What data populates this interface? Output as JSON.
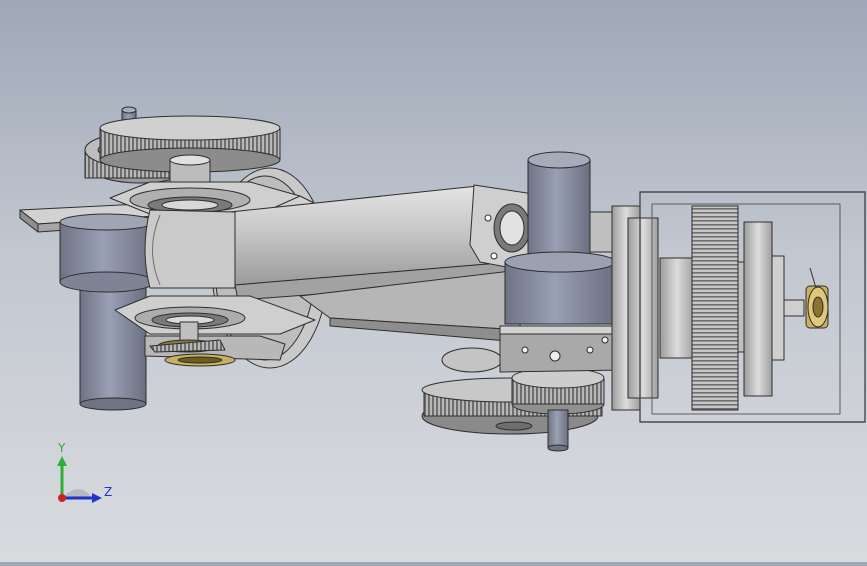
{
  "view": {
    "kind": "cad-3d-viewport",
    "model": "gear-drive-arm-assembly",
    "colors": {
      "bg_top": "#9fa8b8",
      "bg_bottom": "#d9dbdf",
      "metal_light": "#d8d8d8",
      "metal_mid": "#b4b4b4",
      "metal_dark": "#8a8a8a",
      "shaft_blue": "#8a8fa3",
      "brass": "#c8b060",
      "edge": "#303030"
    }
  },
  "triad": {
    "y_label": "Y",
    "z_label": "Z",
    "y_color": "#2fae3a",
    "z_color": "#2233cc",
    "x_color": "#cc2222"
  }
}
